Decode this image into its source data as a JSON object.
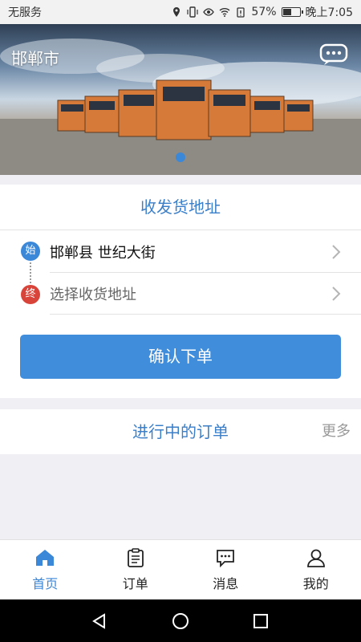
{
  "status_bar": {
    "carrier": "无服务",
    "battery": "57%",
    "battery_level": 0.57,
    "time": "晚上7:05"
  },
  "banner": {
    "city": "邯郸市",
    "chat_icon": "chat-bubble-icon",
    "page_dot_color": "#3b87d8"
  },
  "address": {
    "title": "收发货地址",
    "start_badge": "始",
    "end_badge": "终",
    "start_value": "邯郸县 世纪大街",
    "end_placeholder": "选择收货地址",
    "confirm_label": "确认下单"
  },
  "orders": {
    "title": "进行中的订单",
    "more": "更多"
  },
  "tabs": [
    {
      "label": "首页",
      "icon": "home-icon",
      "active": true
    },
    {
      "label": "订单",
      "icon": "clipboard-icon",
      "active": false
    },
    {
      "label": "消息",
      "icon": "message-icon",
      "active": false
    },
    {
      "label": "我的",
      "icon": "user-icon",
      "active": false
    }
  ],
  "colors": {
    "accent": "#3b87d8",
    "end_badge": "#d9443a",
    "button": "#3f8ddb"
  }
}
